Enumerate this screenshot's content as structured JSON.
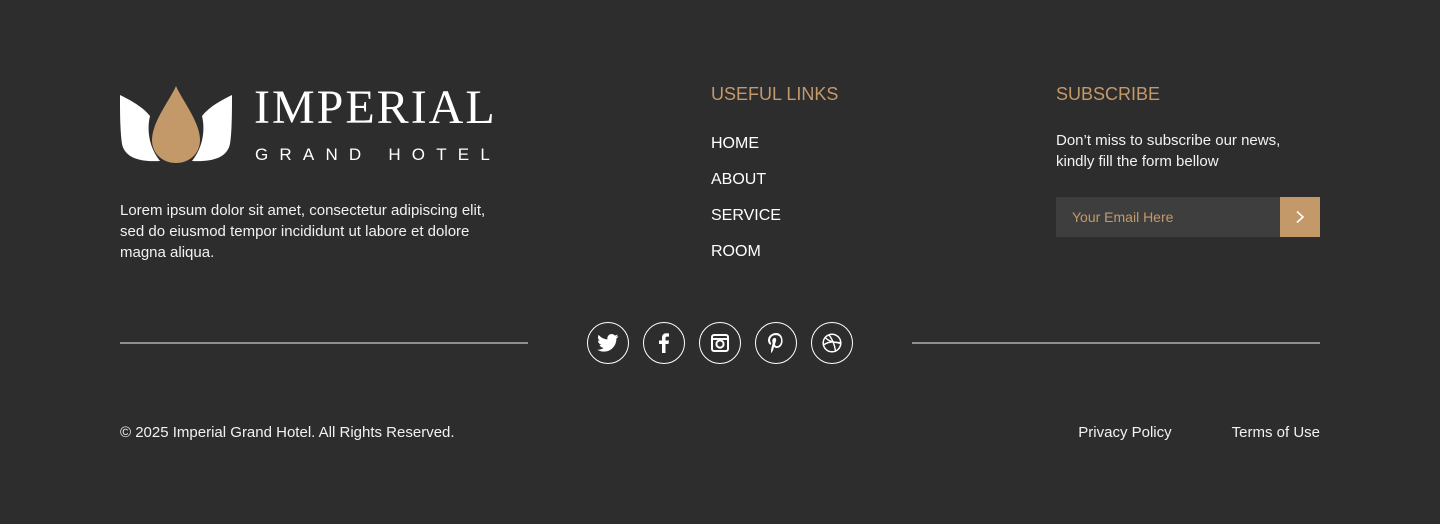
{
  "brand": {
    "title": "IMPERIAL",
    "subtitle": "GRAND HOTEL",
    "description": "Lorem ipsum dolor sit amet, consectetur adipiscing elit, sed do eiusmod tempor incididunt ut labore et dolore magna aliqua.",
    "logo_icon": "lotus-drop-icon"
  },
  "useful_links": {
    "heading": "USEFUL LINKS",
    "items": [
      {
        "label": "HOME"
      },
      {
        "label": "ABOUT"
      },
      {
        "label": "SERVICE"
      },
      {
        "label": "ROOM"
      }
    ]
  },
  "subscribe": {
    "heading": "SUBSCRIBE",
    "text": "Don’t miss to subscribe our news, kindly fill the form bellow",
    "email_placeholder": "Your Email Here",
    "submit_icon": "chevron-right-icon"
  },
  "social": {
    "icons": [
      "twitter-icon",
      "facebook-icon",
      "instagram-icon",
      "pinterest-icon",
      "dribbble-icon"
    ]
  },
  "bottom": {
    "copyright": "© 2025 Imperial Grand Hotel. All Rights Reserved.",
    "privacy": "Privacy Policy",
    "terms": "Terms of Use"
  },
  "colors": {
    "background": "#2d2d2d",
    "accent": "#c4996a",
    "text": "#ffffff",
    "input_bg": "#3e3e3e",
    "divider": "#8f8f8f"
  }
}
